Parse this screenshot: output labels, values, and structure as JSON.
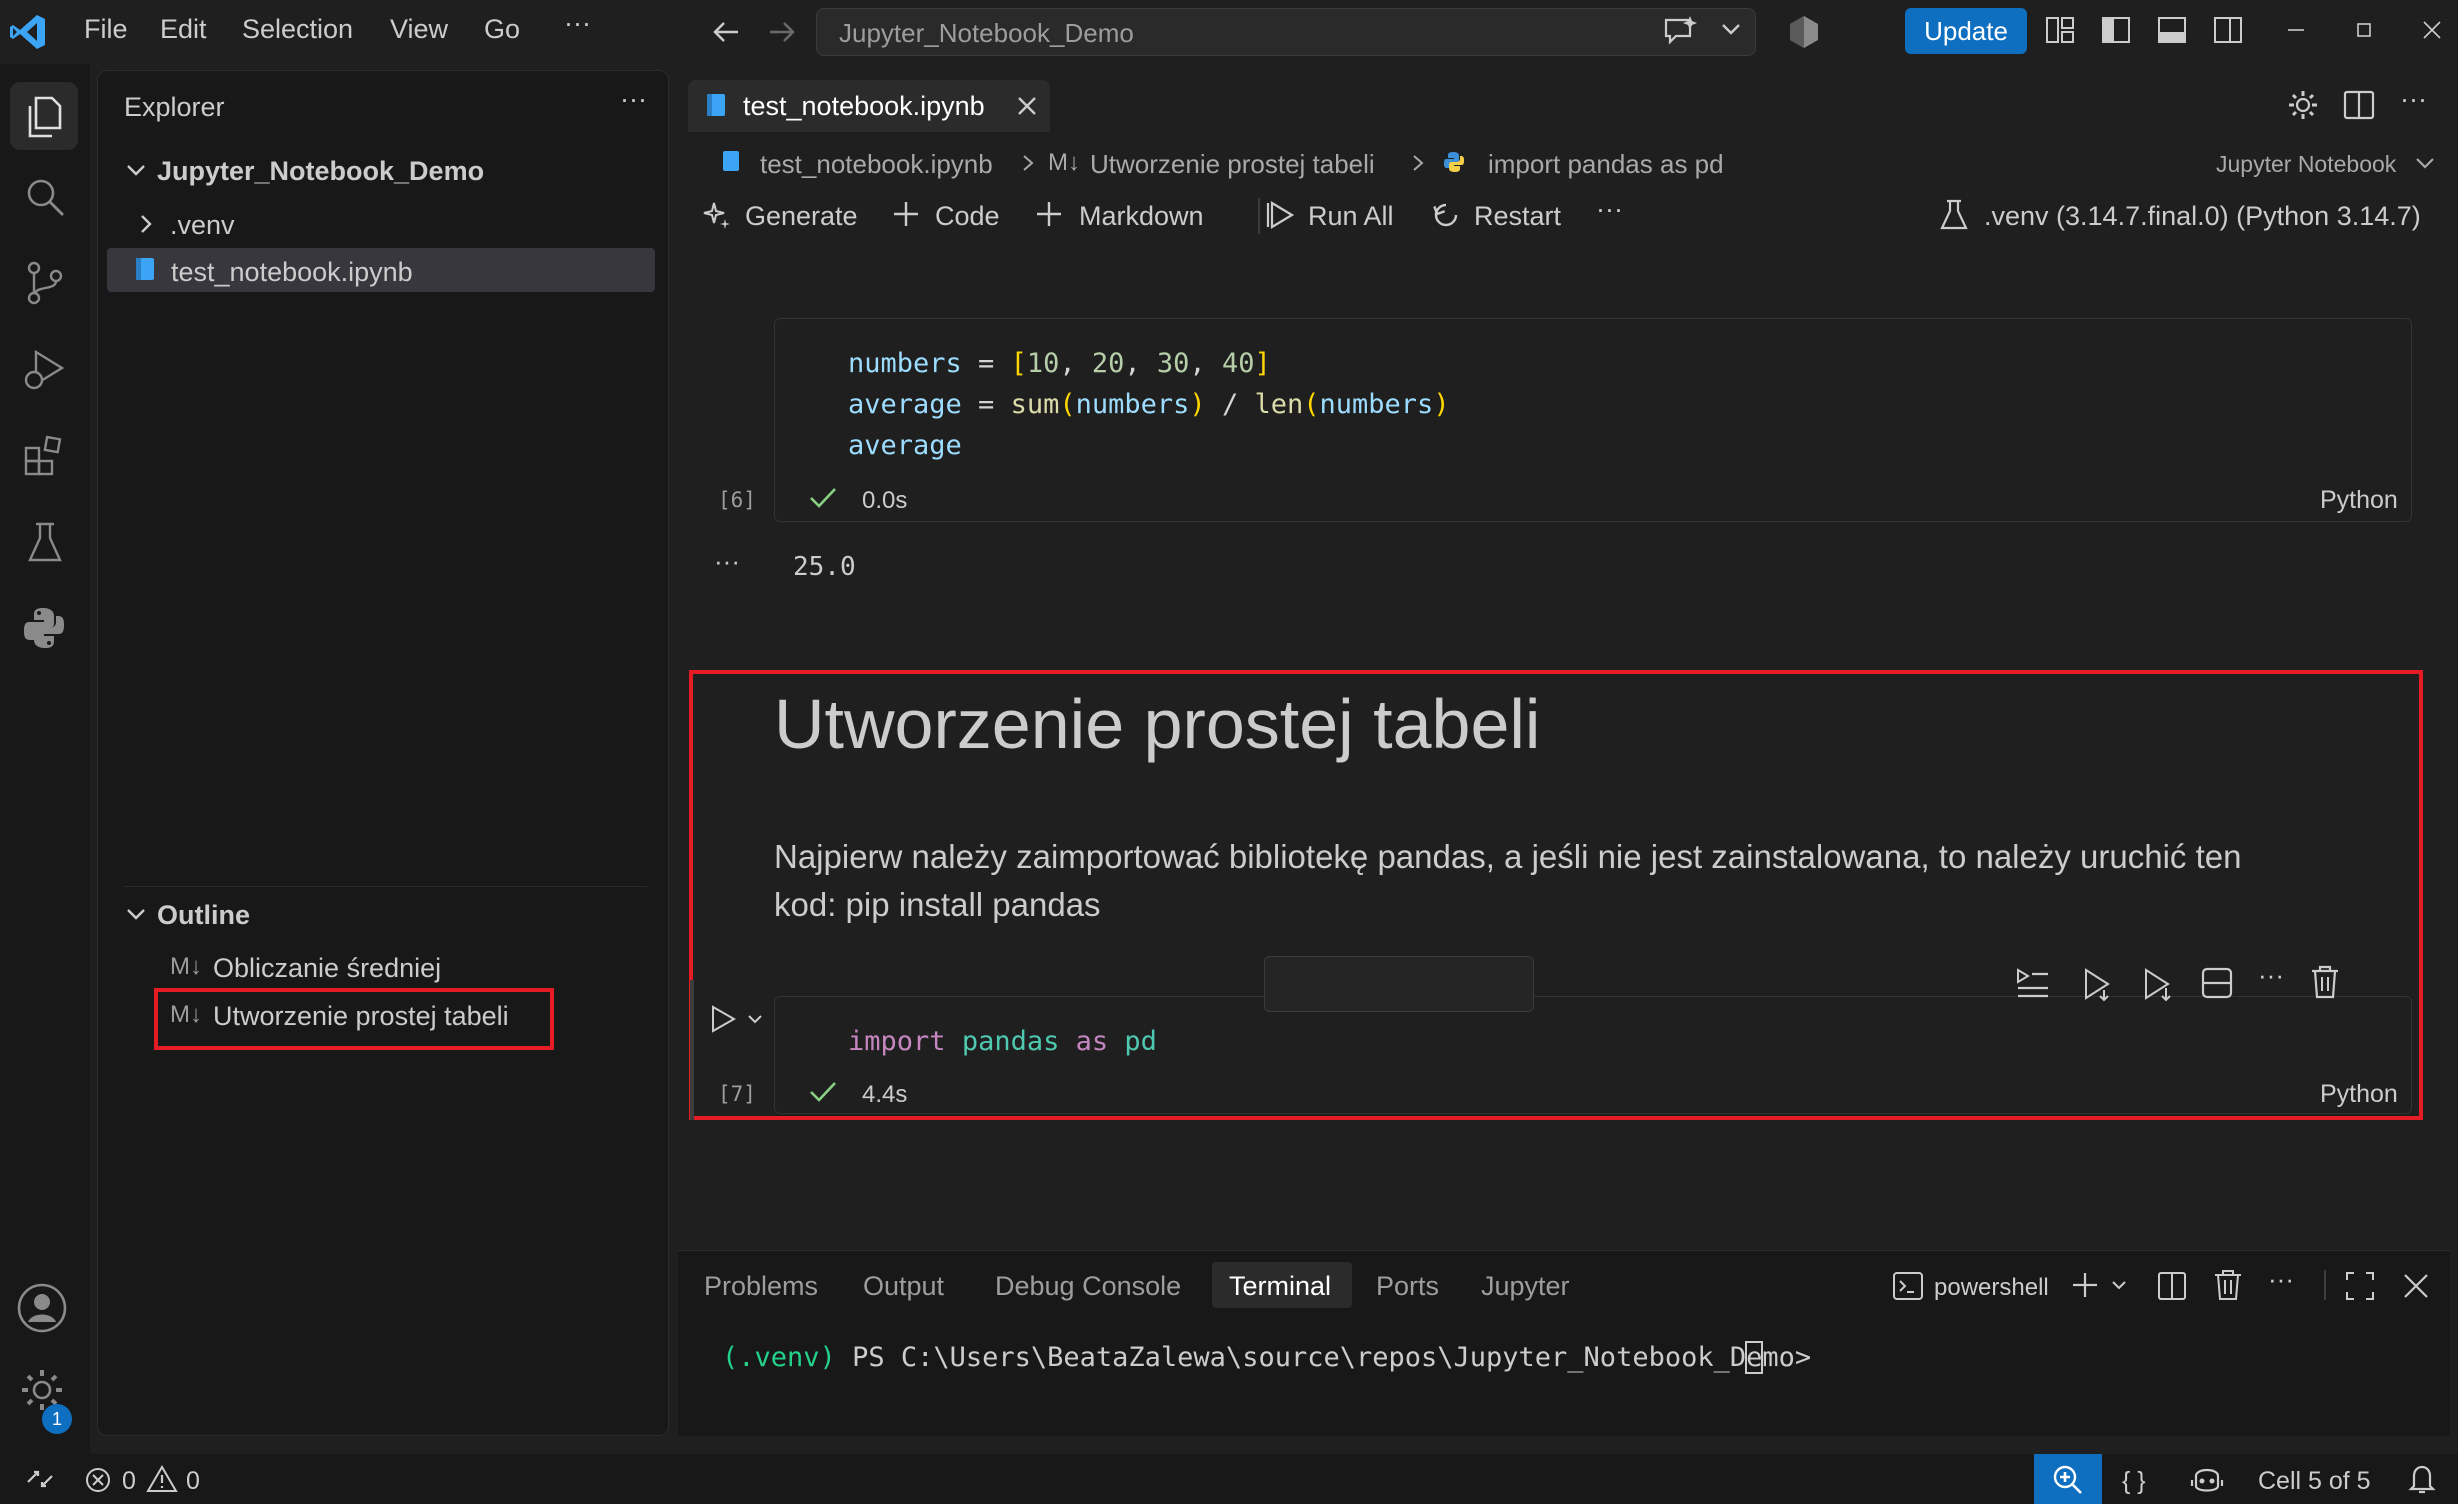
{
  "titlebar": {
    "menus": [
      "File",
      "Edit",
      "Selection",
      "View",
      "Go"
    ],
    "more": "···",
    "search_text": "Jupyter_Notebook_Demo",
    "update_label": "Update"
  },
  "sidebar": {
    "explorer_title": "Explorer",
    "more": "···",
    "folder_name": "Jupyter_Notebook_Demo",
    "venv_folder": ".venv",
    "file_name": "test_notebook.ipynb",
    "outline_title": "Outline",
    "outline_items": [
      "Obliczanie średniej",
      "Utworzenie prostej tabeli"
    ],
    "md_glyph": "M↓"
  },
  "editor": {
    "tab_label": "test_notebook.ipynb",
    "breadcrumb": {
      "file": "test_notebook.ipynb",
      "section": "Utworzenie prostej tabeli",
      "cell": "import pandas as pd",
      "md_glyph": "M↓"
    },
    "notebook_type": "Jupyter Notebook",
    "toolbar": {
      "generate": "Generate",
      "code": "Code",
      "markdown": "Markdown",
      "run_all": "Run All",
      "restart": "Restart",
      "more": "···"
    },
    "kernel": ".venv (3.14.7.final.0) (Python 3.14.7)",
    "cell6": {
      "exec_count": "[6]",
      "time": "0.0s",
      "lang": "Python",
      "output": "25.0",
      "output_ellipsis": "···"
    },
    "markdown_cell": {
      "heading": "Utworzenie prostej tabeli",
      "paragraph_line1": "Najpierw należy zaimportować bibliotekę pandas, a jeśli nie jest zainstalowana, to należy uruchić ten",
      "paragraph_line2": "kod: pip install pandas"
    },
    "cell7": {
      "exec_count": "[7]",
      "time": "4.4s",
      "lang": "Python",
      "cell_more": "···"
    }
  },
  "panel": {
    "tabs": [
      "Problems",
      "Output",
      "Debug Console",
      "Terminal",
      "Ports",
      "Jupyter"
    ],
    "active_tab": "Terminal",
    "shell": "powershell",
    "more": "···",
    "terminal_env": "(.venv)",
    "terminal_prompt_before": "PS C:\\Users\\BeataZalewa\\source\\repos\\Jupyter_Notebook_D",
    "terminal_cursor_char": "e",
    "terminal_prompt_after": "mo>"
  },
  "statusbar": {
    "errors": "0",
    "warnings": "0",
    "braces": "{ }",
    "cell_position": "Cell 5 of 5",
    "settings_badge": "1"
  },
  "colors": {
    "accent": "#0e6fc1",
    "highlight_box": "#e51c23",
    "success": "#89d185",
    "terminal_env": "#23d18b"
  }
}
